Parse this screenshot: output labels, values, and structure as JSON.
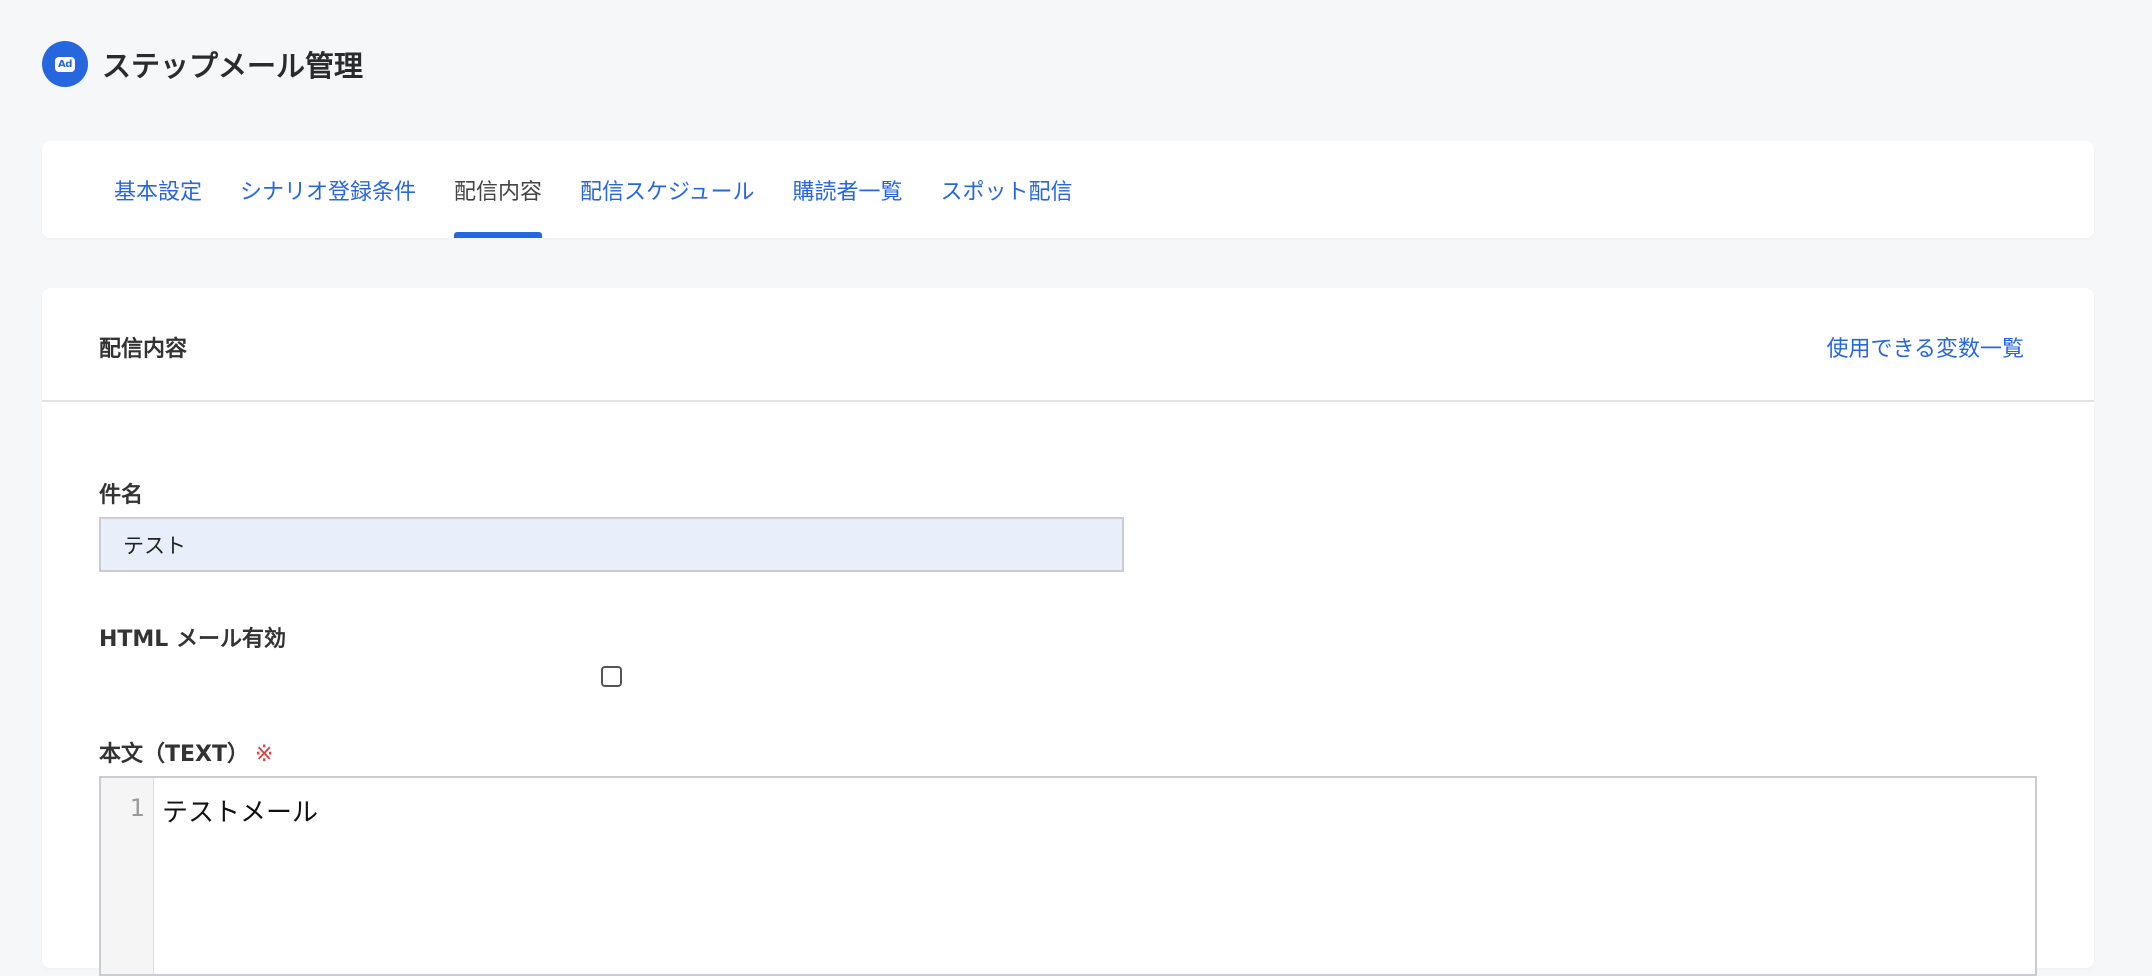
{
  "header": {
    "logo_text": "Ad",
    "title": "ステップメール管理"
  },
  "tabs": [
    {
      "label": "基本設定",
      "active": false
    },
    {
      "label": "シナリオ登録条件",
      "active": false
    },
    {
      "label": "配信内容",
      "active": true
    },
    {
      "label": "配信スケジュール",
      "active": false
    },
    {
      "label": "購読者一覧",
      "active": false
    },
    {
      "label": "スポット配信",
      "active": false
    }
  ],
  "content": {
    "title": "配信内容",
    "variables_link": "使用できる変数一覧",
    "subject": {
      "label": "件名",
      "value": "テスト"
    },
    "html_mail": {
      "label": "HTML メール有効",
      "checked": false
    },
    "body_text": {
      "label": "本文（TEXT）",
      "required_mark": "※",
      "line_number": "1",
      "value": "テストメール"
    }
  },
  "colors": {
    "accent": "#2667e0",
    "required": "#e03b3b",
    "input_bg": "#e8effb",
    "page_bg": "#f6f7f9"
  }
}
